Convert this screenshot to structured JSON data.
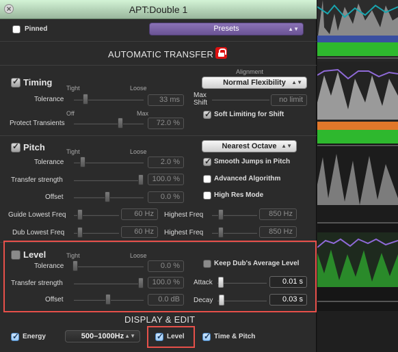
{
  "window": {
    "title": "APT:Double 1"
  },
  "header": {
    "pinned_label": "Pinned",
    "presets_label": "Presets"
  },
  "automatic_transfer": {
    "title": "AUTOMATIC TRANSFER",
    "timing": {
      "label": "Timing",
      "tight": "Tight",
      "loose": "Loose",
      "tolerance_label": "Tolerance",
      "tolerance_value": "33 ms",
      "protect_label": "Protect Transients",
      "off": "Off",
      "max": "Max",
      "protect_value": "72.0 %",
      "alignment_label": "Alignment",
      "alignment_value": "Normal Flexibility",
      "max_shift_label": "Max Shift",
      "max_shift_value": "no limit",
      "soft_limiting_label": "Soft Limiting for Shift"
    },
    "pitch": {
      "label": "Pitch",
      "tight": "Tight",
      "loose": "Loose",
      "tolerance_label": "Tolerance",
      "tolerance_value": "2.0 %",
      "transfer_label": "Transfer strength",
      "transfer_value": "100.0 %",
      "offset_label": "Offset",
      "offset_value": "0.0 %",
      "guide_lowest_label": "Guide Lowest Freq",
      "guide_lowest_value": "60 Hz",
      "guide_highest_label": "Highest Freq",
      "guide_highest_value": "850 Hz",
      "dub_lowest_label": "Dub Lowest Freq",
      "dub_lowest_value": "60 Hz",
      "dub_highest_label": "Highest Freq",
      "dub_highest_value": "850 Hz",
      "octave_value": "Nearest Octave",
      "smooth_jumps_label": "Smooth Jumps in Pitch",
      "advanced_label": "Advanced Algorithm",
      "high_res_label": "High Res Mode"
    },
    "level": {
      "label": "Level",
      "tight": "Tight",
      "loose": "Loose",
      "tolerance_label": "Tolerance",
      "tolerance_value": "0.0 %",
      "transfer_label": "Transfer strength",
      "transfer_value": "100.0 %",
      "offset_label": "Offset",
      "offset_value": "0.0 dB",
      "keep_dub_label": "Keep Dub's Average Level",
      "attack_label": "Attack",
      "attack_value": "0.01 s",
      "decay_label": "Decay",
      "decay_value": "0.03 s"
    }
  },
  "display_edit": {
    "title": "DISPLAY & EDIT",
    "energy_label": "Energy",
    "energy_range": "500–1000Hz",
    "level_label": "Level",
    "time_pitch_label": "Time & Pitch"
  },
  "colors": {
    "presets": "#6f58a0",
    "highlight": "#e8504a",
    "accent_checkbox": "#9ccaf5",
    "lock": "#dd1111"
  }
}
